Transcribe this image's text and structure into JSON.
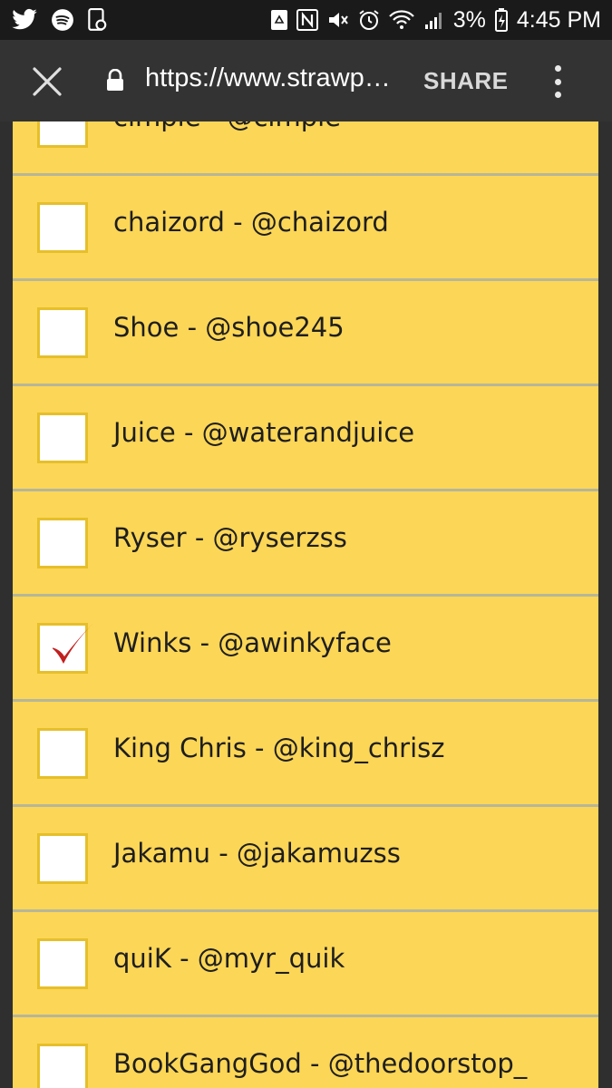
{
  "status_bar": {
    "battery_percent": "3%",
    "time": "4:45 PM"
  },
  "toolbar": {
    "url": "https://www.strawp…",
    "share_label": "SHARE"
  },
  "poll": {
    "options": [
      {
        "label": "cimple - @cimple",
        "checked": false
      },
      {
        "label": "chaizord - @chaizord",
        "checked": false
      },
      {
        "label": "Shoe - @shoe245",
        "checked": false
      },
      {
        "label": "Juice - @waterandjuice",
        "checked": false
      },
      {
        "label": "Ryser - @ryserzss",
        "checked": false
      },
      {
        "label": "Winks - @awinkyface",
        "checked": true
      },
      {
        "label": "King Chris - @king_chrisz",
        "checked": false
      },
      {
        "label": "Jakamu - @jakamuzss",
        "checked": false
      },
      {
        "label": "quiK - @myr_quik",
        "checked": false
      },
      {
        "label": "BookGangGod - @thedoorstop_",
        "checked": false
      }
    ]
  },
  "colors": {
    "panel_bg": "#fcd656",
    "checkbox_border": "#e6bf2a",
    "checkmark": "#c0201e",
    "toolbar_bg": "#333333",
    "status_bar_bg": "#1a1a1a"
  },
  "icons": [
    "twitter-icon",
    "spotify-icon",
    "screenshot-icon",
    "recycle-icon",
    "nfc-icon",
    "vibrate-mute-icon",
    "alarm-icon",
    "wifi-icon",
    "cell-signal-icon",
    "battery-icon",
    "close-icon",
    "lock-icon",
    "more-vert-icon",
    "checkmark-icon"
  ]
}
